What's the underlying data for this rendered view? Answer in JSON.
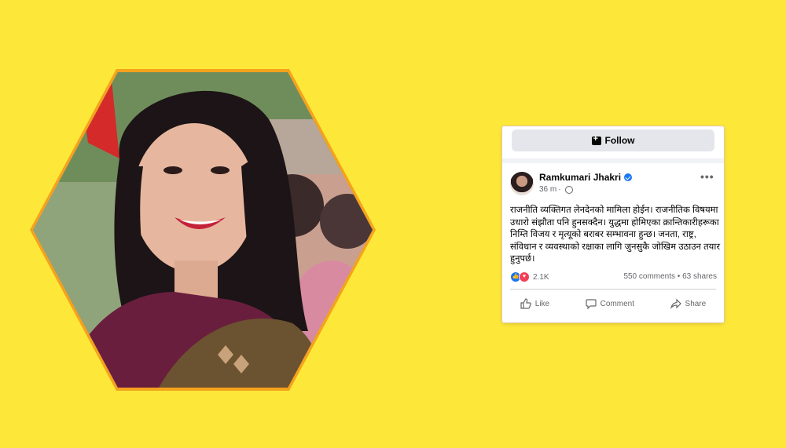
{
  "colors": {
    "background": "#fde83a",
    "hex_border": "#f5a21c",
    "facebook_blue": "#1877f2",
    "love_red": "#f33e58"
  },
  "post": {
    "follow_label": "Follow",
    "author": "Ramkumari Jhakri",
    "time": "36 m",
    "more_label": "•••",
    "text": "राजनीति व्यक्तिगत लेनदेनको मामिला होईन। राजनीतिक विषयमा उधारो संझौता पनि हुनसक्दैन। युद्धमा होमिएका क्रान्तिकारीहरूका निम्ति विजय र मृत्यूको बराबर सम्भावना हुन्छ। जनता, राष्ट्र, संविधान र व्यवस्थाको रक्षाका लागि जुनसुकै जोखिम उठाउन तयार हुनुपर्छ।",
    "reaction_count": "2.1K",
    "comments_shares": "550 comments • 63 shares",
    "actions": {
      "like": "Like",
      "comment": "Comment",
      "share": "Share"
    }
  },
  "icons": {
    "follow": "follow-icon",
    "verified": "verified-badge-icon",
    "privacy": "globe-icon",
    "like_reaction": "like-reaction-icon",
    "love_reaction": "love-reaction-icon"
  }
}
